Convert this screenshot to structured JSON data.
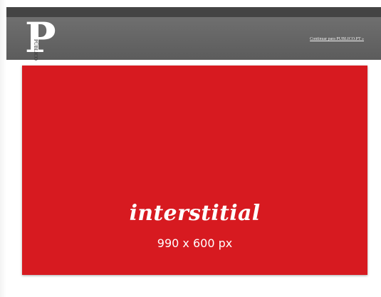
{
  "header": {
    "logo_letter": "P",
    "logo_word": "PÚBLICO",
    "continue_link": "Continuar para PUBLICO.PT »"
  },
  "ad": {
    "title": "interstitial",
    "size": "990 x 600 px",
    "background_color": "#d71a20"
  },
  "colors": {
    "topbar": "#444444",
    "header": "#666666"
  },
  "icons": [
    "publico-logo"
  ]
}
